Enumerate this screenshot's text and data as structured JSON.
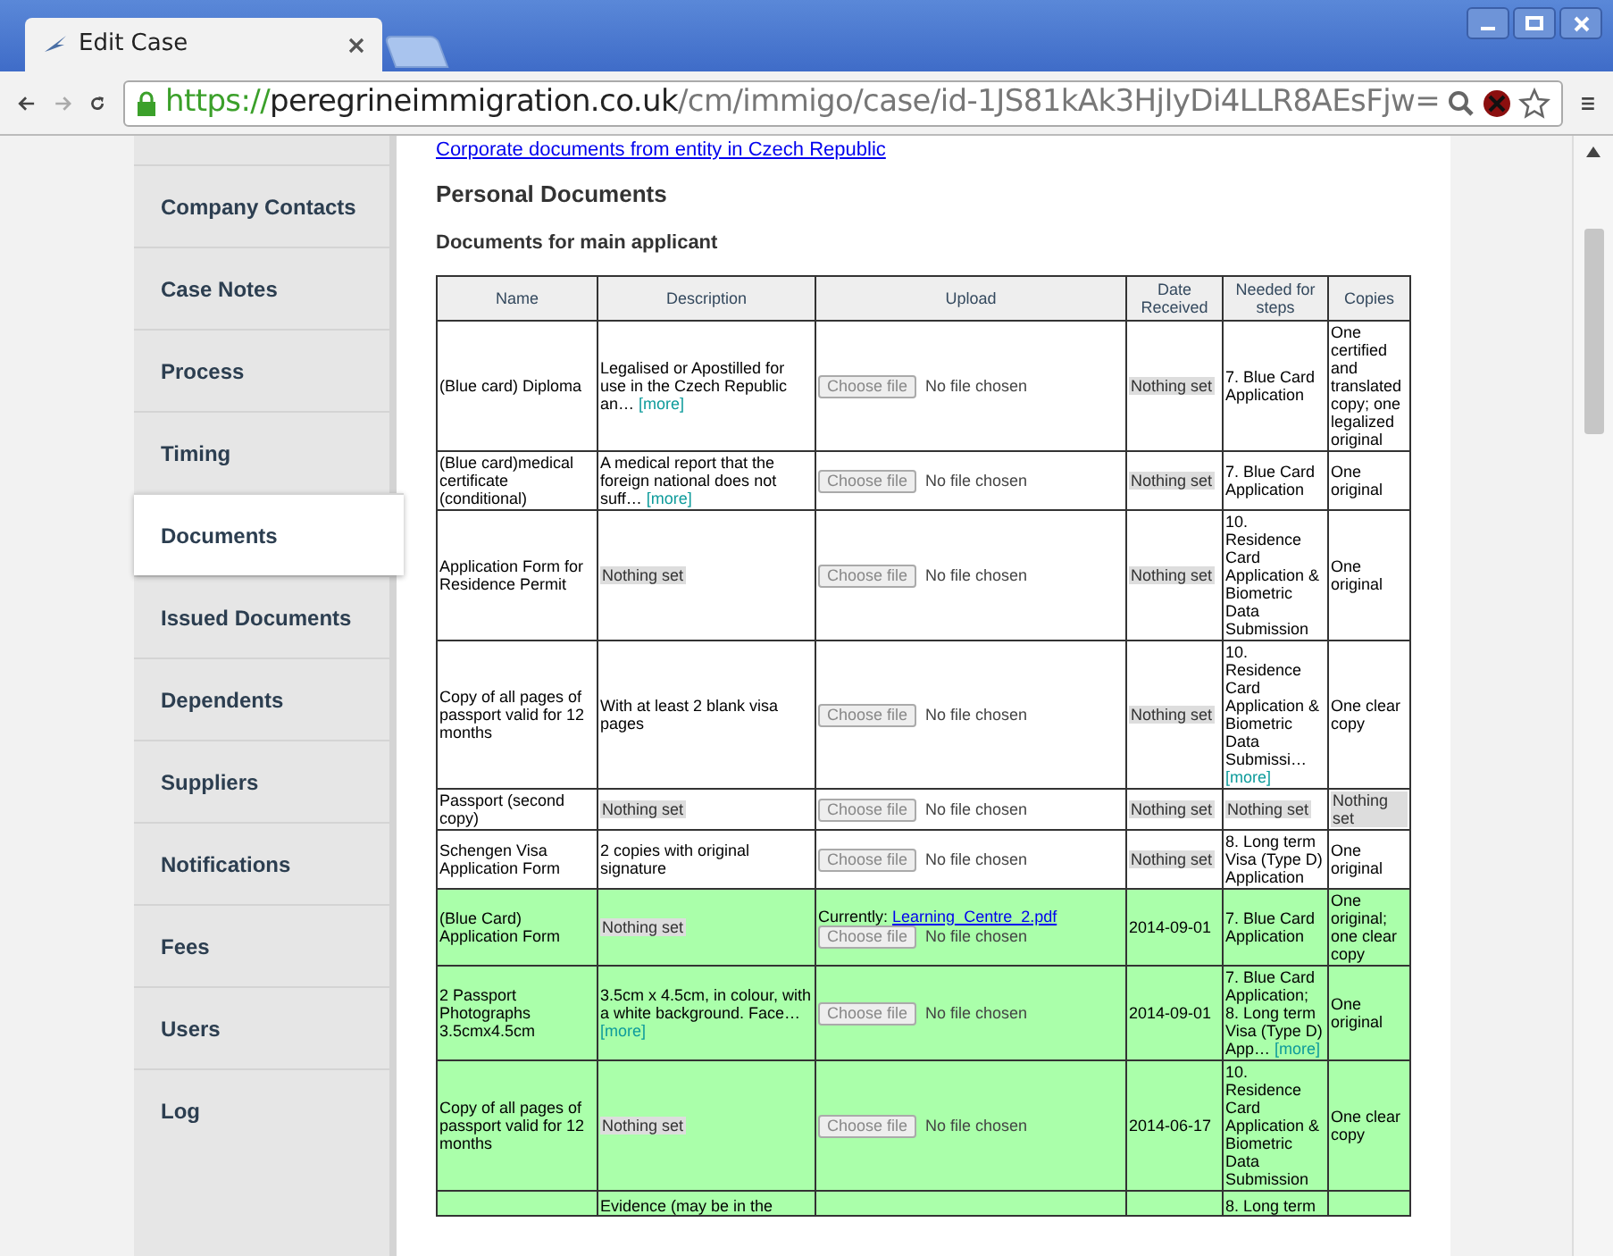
{
  "window": {
    "tab_title": "Edit Case",
    "url": {
      "scheme": "https://",
      "host": "peregrineimmigration.co.uk",
      "path": "/cm/immigo/case/id-1JS81kAk3HjIyDi4LLR8AEsFjw="
    }
  },
  "sidebar": {
    "items": [
      {
        "label": "Company Contacts",
        "selected": false
      },
      {
        "label": "Case Notes",
        "selected": false
      },
      {
        "label": "Process",
        "selected": false
      },
      {
        "label": "Timing",
        "selected": false
      },
      {
        "label": "Documents",
        "selected": true
      },
      {
        "label": "Issued Documents",
        "selected": false
      },
      {
        "label": "Dependents",
        "selected": false
      },
      {
        "label": "Suppliers",
        "selected": false
      },
      {
        "label": "Notifications",
        "selected": false
      },
      {
        "label": "Fees",
        "selected": false
      },
      {
        "label": "Users",
        "selected": false
      },
      {
        "label": "Log",
        "selected": false
      }
    ]
  },
  "main": {
    "top_link": "Corporate documents from entity in Czech Republic",
    "section_title": "Personal Documents",
    "subsection_title": "Documents for main applicant",
    "table": {
      "columns": [
        "Name",
        "Description",
        "Upload",
        "Date Received",
        "Needed for steps",
        "Copies"
      ],
      "rows": [
        {
          "received": false,
          "name": "(Blue card) Diploma",
          "description": {
            "kind": "text",
            "text": "Legalised or Apostilled for use in the Czech Republic an…",
            "more": "[more]"
          },
          "upload": {
            "button": "Choose file",
            "status": "No file chosen"
          },
          "date": {
            "kind": "unset",
            "text": "Nothing set"
          },
          "steps": {
            "kind": "text",
            "text": "7. Blue Card Application"
          },
          "copies": {
            "kind": "text",
            "text": "One certified and translated copy; one legalized original"
          }
        },
        {
          "received": false,
          "name": "(Blue card)medical certificate (conditional)",
          "description": {
            "kind": "text",
            "text": "A medical report that the foreign national does not suff…",
            "more": "[more]"
          },
          "upload": {
            "button": "Choose file",
            "status": "No file chosen"
          },
          "date": {
            "kind": "unset",
            "text": "Nothing set"
          },
          "steps": {
            "kind": "text",
            "text": "7. Blue Card Application"
          },
          "copies": {
            "kind": "text",
            "text": "One original"
          }
        },
        {
          "received": false,
          "name": "Application Form for Residence Permit",
          "description": {
            "kind": "unset",
            "text": "Nothing set"
          },
          "upload": {
            "button": "Choose file",
            "status": "No file chosen"
          },
          "date": {
            "kind": "unset",
            "text": "Nothing set"
          },
          "steps": {
            "kind": "text",
            "text": "10. Residence Card Application & Biometric Data Submission"
          },
          "copies": {
            "kind": "text",
            "text": "One original"
          }
        },
        {
          "received": false,
          "name": "Copy of all pages of passport valid for 12 months",
          "description": {
            "kind": "text",
            "text": "With at least 2 blank visa pages"
          },
          "upload": {
            "button": "Choose file",
            "status": "No file chosen"
          },
          "date": {
            "kind": "unset",
            "text": "Nothing set"
          },
          "steps": {
            "kind": "text",
            "text": "10. Residence Card Application & Biometric Data Submissi…",
            "more": "[more]"
          },
          "copies": {
            "kind": "text",
            "text": "One clear copy"
          }
        },
        {
          "received": false,
          "name": "Passport (second copy)",
          "description": {
            "kind": "unset",
            "text": "Nothing set"
          },
          "upload": {
            "button": "Choose file",
            "status": "No file chosen"
          },
          "date": {
            "kind": "unset",
            "text": "Nothing set"
          },
          "steps": {
            "kind": "unset",
            "text": "Nothing set"
          },
          "copies": {
            "kind": "unset",
            "text": "Nothing set"
          }
        },
        {
          "received": false,
          "name": "Schengen Visa Application Form",
          "description": {
            "kind": "text",
            "text": "2 copies with original signature"
          },
          "upload": {
            "button": "Choose file",
            "status": "No file chosen"
          },
          "date": {
            "kind": "unset",
            "text": "Nothing set"
          },
          "steps": {
            "kind": "text",
            "text": "8. Long term Visa (Type D) Application"
          },
          "copies": {
            "kind": "text",
            "text": "One original"
          }
        },
        {
          "received": true,
          "name": "(Blue Card) Application Form",
          "description": {
            "kind": "unset",
            "text": "Nothing set"
          },
          "upload": {
            "current_label": "Currently:",
            "current_file": "Learning_Centre_2.pdf",
            "button": "Choose file",
            "status": "No file chosen"
          },
          "date": {
            "kind": "text",
            "text": "2014-09-01"
          },
          "steps": {
            "kind": "text",
            "text": "7. Blue Card Application"
          },
          "copies": {
            "kind": "text",
            "text": "One original; one clear copy"
          }
        },
        {
          "received": true,
          "name": "2 Passport Photographs 3.5cmx4.5cm",
          "description": {
            "kind": "text",
            "text": "3.5cm x 4.5cm, in colour, with a white background. Face…",
            "more": "[more]"
          },
          "upload": {
            "button": "Choose file",
            "status": "No file chosen"
          },
          "date": {
            "kind": "text",
            "text": "2014-09-01"
          },
          "steps": {
            "kind": "text",
            "text": "7. Blue Card Application; 8. Long term Visa (Type D) App…",
            "more": "[more]"
          },
          "copies": {
            "kind": "text",
            "text": "One original"
          }
        },
        {
          "received": true,
          "name": "Copy of all pages of passport valid for 12 months",
          "description": {
            "kind": "unset",
            "text": "Nothing set"
          },
          "upload": {
            "button": "Choose file",
            "status": "No file chosen"
          },
          "date": {
            "kind": "text",
            "text": "2014-06-17"
          },
          "steps": {
            "kind": "text",
            "text": "10. Residence Card Application & Biometric Data Submission"
          },
          "copies": {
            "kind": "text",
            "text": "One clear copy"
          }
        },
        {
          "received": true,
          "description": {
            "kind": "text",
            "text": "Evidence (may be in the"
          },
          "upload": {},
          "steps": {
            "kind": "text",
            "text": "8. Long term"
          }
        }
      ]
    }
  }
}
